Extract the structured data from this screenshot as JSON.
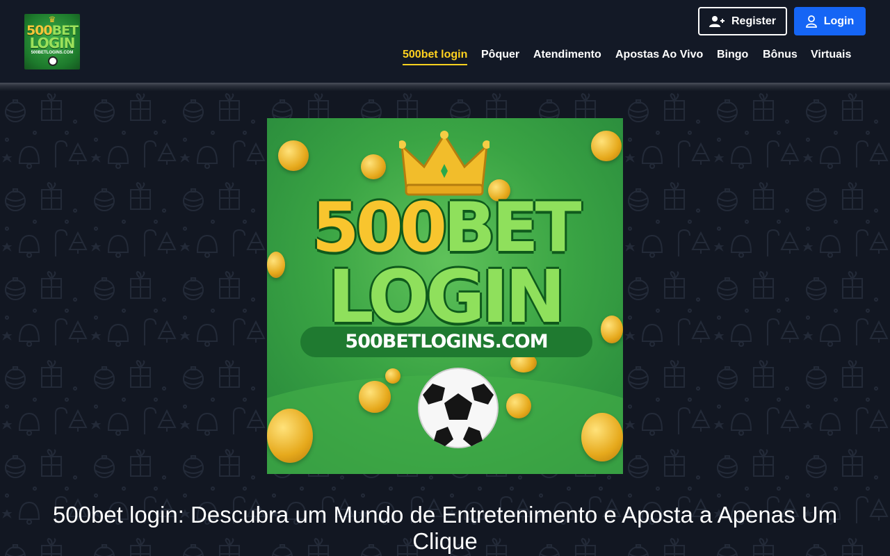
{
  "header": {
    "logo": {
      "line1_a": "500",
      "line1_b": "BET",
      "line2": "LOGIN",
      "line3": "500BETLOGINS.COM"
    },
    "register_label": "Register",
    "login_label": "Login",
    "register_icon": "user-plus-icon",
    "login_icon": "user-icon",
    "accent_color": "#1565f5",
    "active_color": "#ffd21f",
    "nav": [
      {
        "label": "500bet login",
        "active": true
      },
      {
        "label": "Pôquer"
      },
      {
        "label": "Atendimento"
      },
      {
        "label": "Apostas Ao Vivo"
      },
      {
        "label": "Bingo"
      },
      {
        "label": "Bônus"
      },
      {
        "label": "Virtuais"
      }
    ]
  },
  "hero": {
    "line1_a": "500",
    "line1_b": "BET",
    "line2": "LOGIN",
    "line3": "500BETLOGINS.COM"
  },
  "main": {
    "headline": "500bet login: Descubra um Mundo de Entretenimento e Aposta a Apenas Um Clique"
  }
}
